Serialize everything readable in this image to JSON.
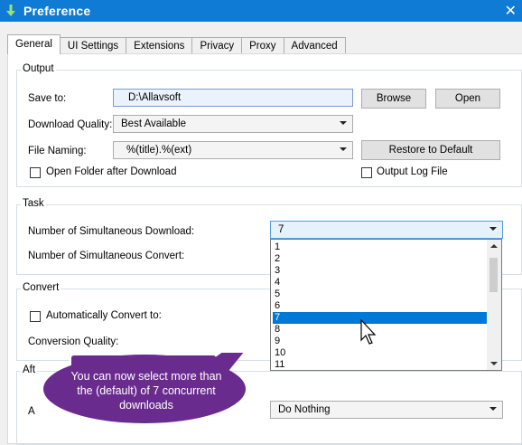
{
  "window": {
    "title": "Preference",
    "icon": "download-arrow-icon",
    "close_glyph": "✕"
  },
  "tabs": [
    "General",
    "UI Settings",
    "Extensions",
    "Privacy",
    "Proxy",
    "Advanced"
  ],
  "output": {
    "legend": "Output",
    "save_to_label": "Save to:",
    "save_to_value": "D:\\Allavsoft",
    "browse_label": "Browse",
    "open_label": "Open",
    "quality_label": "Download Quality:",
    "quality_value": "Best Available",
    "naming_label": "File Naming:",
    "naming_value": "%(title).%(ext)",
    "restore_label": "Restore to Default",
    "open_folder_label": "Open Folder after Download",
    "output_log_label": "Output Log File"
  },
  "task": {
    "legend": "Task",
    "sim_download_label": "Number of Simultaneous Download:",
    "sim_download_value": "7",
    "sim_convert_label": "Number of Simultaneous Convert:"
  },
  "dropdown": {
    "options": [
      "1",
      "2",
      "3",
      "4",
      "5",
      "6",
      "7",
      "8",
      "9",
      "10",
      "11"
    ],
    "selected": "7"
  },
  "convert": {
    "legend": "Convert",
    "auto_convert_label": "Automatically Convert to:",
    "quality_label": "Conversion Quality:"
  },
  "after": {
    "legend_partial": "Aft",
    "row_label_partial": "A",
    "action_value": "Do Nothing"
  },
  "callout": {
    "text": "You can now select more than the (default) of 7 concurrent downloads"
  },
  "colors": {
    "title_bar": "#0f7bd5",
    "selection": "#0078d7",
    "callout": "#6a2b8f"
  }
}
